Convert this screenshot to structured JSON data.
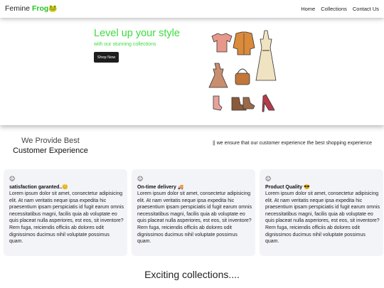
{
  "navbar": {
    "brand_prefix": "Femine",
    "brand_highlight": "Frog",
    "brand_icon": "🐸",
    "links": [
      "Home",
      "Collections",
      "Contact Us"
    ]
  },
  "hero": {
    "title": "Level up your style",
    "subtitle": "with our stunning collections",
    "cta_label": "Shop Now",
    "image_icon": "clothing-collage"
  },
  "provide": {
    "line1": "We Provide Best",
    "line2": "Customer Experience",
    "note": "|| we ensure that our customer experience the best shopping experience"
  },
  "cards": [
    {
      "icon": "☺",
      "title": "satisfaction garanted..😊",
      "body": "Lorem ipsum dolor sit amet, consectetur adipisicing elit. At nam veritatis neque ipsa expedita hic praesentium ipsam perspiciatis id fugit earum omnis necessitatibus magni, facilis quia ab voluptate eo quis placeat nulla asperiores, est eos, sit inventore? Rem fuga, reiciendis officiis ab dolores odit dignissimos ducimus nihil voluptate possimus quam."
    },
    {
      "icon": "☺",
      "title": "On-time delivery 🚚",
      "body": "Lorem ipsum dolor sit amet, consectetur adipisicing elit. At nam veritatis neque ipsa expedita hic praesentium ipsam perspiciatis id fugit earum omnis necessitatibus magni, facilis quia ab voluptate eo quis placeat nulla asperiores, est eos, sit inventore? Rem fuga, reiciendis officiis ab dolores odit dignissimos ducimus nihil voluptate possimus quam."
    },
    {
      "icon": "☺",
      "title": "Product Quality 😎",
      "body": "Lorem ipsum dolor sit amet, consectetur adipisicing elit. At nam veritatis neque ipsa expedita hic praesentium ipsam perspiciatis id fugit earum omnis necessitatibus magni, facilis quia ab voluptate eo quis placeat nulla asperiores, est eos, sit inventore? Rem fuga, reiciendis officiis ab dolores odit dignissimos ducimus nihil voluptate possimus quam."
    }
  ],
  "collections": {
    "title": "Exciting collections...."
  },
  "colors": {
    "accent_green": "#3ddc3d",
    "button_dark": "#1e1e1e",
    "card_bg": "#f3f4f8"
  }
}
